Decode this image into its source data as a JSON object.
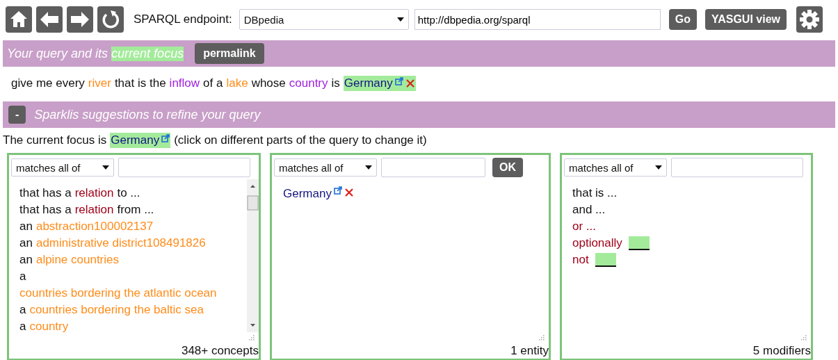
{
  "toolbar": {
    "endpoint_label": "SPARQL endpoint:",
    "endpoint_select": "DBpedia",
    "endpoint_url": "http://dbpedia.org/sparql",
    "buttons": [
      "Go",
      "YASGUI view"
    ]
  },
  "query_header": {
    "title": [
      {
        "kind": "text",
        "text": "Your query and its"
      },
      {
        "kind": "focus",
        "text": "current focus"
      }
    ],
    "button": "permalink"
  },
  "query": [
    {
      "kind": "text",
      "text": "give me every"
    },
    {
      "kind": "class",
      "text": "river"
    },
    {
      "kind": "text",
      "text": "that is the"
    },
    {
      "kind": "property",
      "text": "inflow"
    },
    {
      "kind": "text",
      "text": "of a"
    },
    {
      "kind": "class",
      "text": "lake"
    },
    {
      "kind": "text",
      "text": "whose"
    },
    {
      "kind": "property",
      "text": "country"
    },
    {
      "kind": "text",
      "text": "is"
    },
    {
      "kind": "entity",
      "text": "Germany",
      "focus": true,
      "removable": true
    }
  ],
  "suggestions_header": {
    "toggle": "-",
    "title": "Sparklis suggestions to refine your query"
  },
  "focus_line": [
    {
      "kind": "text",
      "text": "The current focus is"
    },
    {
      "kind": "entity",
      "text": "Germany",
      "focus": true,
      "removable": false
    },
    {
      "kind": "text",
      "text": "(click on different parts of the query to change it)"
    }
  ],
  "panels": [
    {
      "mode": "matches all of",
      "scrollable": true,
      "count": "348+ concepts",
      "items": [
        [
          {
            "kind": "text",
            "text": "that has a"
          },
          {
            "kind": "relation",
            "text": "relation"
          },
          {
            "kind": "text",
            "text": "to ..."
          }
        ],
        [
          {
            "kind": "text",
            "text": "that has a"
          },
          {
            "kind": "relation",
            "text": "relation"
          },
          {
            "kind": "text",
            "text": "from ..."
          }
        ],
        [
          {
            "kind": "text",
            "text": "an"
          },
          {
            "kind": "class",
            "text": "abstraction100002137"
          }
        ],
        [
          {
            "kind": "text",
            "text": "an"
          },
          {
            "kind": "class",
            "text": "administrative district108491826"
          }
        ],
        [
          {
            "kind": "text",
            "text": "an"
          },
          {
            "kind": "class",
            "text": "alpine countries"
          }
        ],
        [
          {
            "kind": "text",
            "text": "a"
          },
          {
            "kind": "class",
            "text": "countries bordering the atlantic ocean"
          }
        ],
        [
          {
            "kind": "text",
            "text": "a"
          },
          {
            "kind": "class",
            "text": "countries bordering the baltic sea"
          }
        ],
        [
          {
            "kind": "text",
            "text": "a"
          },
          {
            "kind": "class",
            "text": "country"
          }
        ]
      ]
    },
    {
      "mode": "matches all of",
      "ok_button": "OK",
      "scrollable": false,
      "count": "1 entity",
      "items": [
        [
          {
            "kind": "entity",
            "text": "Germany",
            "focus": false,
            "removable": true
          }
        ]
      ]
    },
    {
      "mode": "matches all of",
      "scrollable": false,
      "count": "5 modifiers",
      "items": [
        [
          {
            "kind": "text",
            "text": "that is ..."
          }
        ],
        [
          {
            "kind": "text",
            "text": "and ..."
          }
        ],
        [
          {
            "kind": "relation",
            "text": "or ..."
          }
        ],
        [
          {
            "kind": "relation",
            "text": "optionally"
          },
          {
            "kind": "blank"
          }
        ],
        [
          {
            "kind": "relation",
            "text": "not"
          },
          {
            "kind": "blank"
          }
        ]
      ]
    }
  ]
}
